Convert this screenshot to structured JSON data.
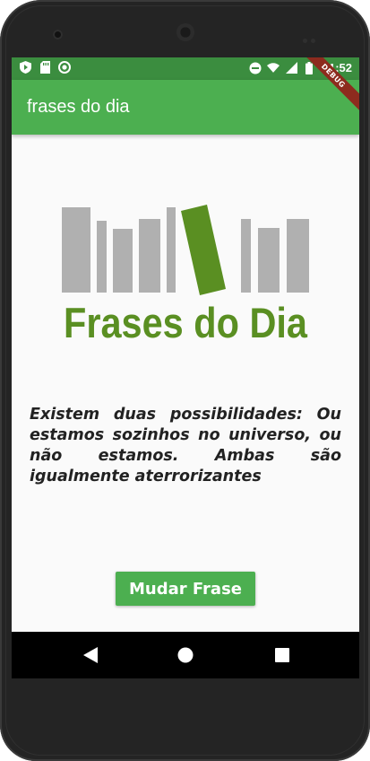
{
  "status_bar": {
    "time": "11:52",
    "left_icons": [
      "play-protect-icon",
      "sd-card-icon",
      "sync-circle-icon"
    ],
    "right_icons": [
      "do-not-disturb-icon",
      "wifi-icon",
      "signal-icon",
      "battery-icon"
    ]
  },
  "app_bar": {
    "title": "frases do dia",
    "debug_banner": "DEBUG"
  },
  "logo": {
    "text": "Frases do Dia",
    "bar_color": "#b0b0b0",
    "accent_color": "#5a8f22"
  },
  "quote": {
    "text": "Existem duas possibilidades: Ou estamos sozinhos no universo, ou não estamos. Ambas são igualmente aterrorizantes"
  },
  "action": {
    "button_label": "Mudar Frase"
  },
  "nav_bar": {
    "icons": [
      "back-icon",
      "home-icon",
      "recents-icon"
    ]
  },
  "colors": {
    "primary": "#4caf50",
    "status_bar": "#3b8d3f",
    "background": "#fafafa"
  }
}
